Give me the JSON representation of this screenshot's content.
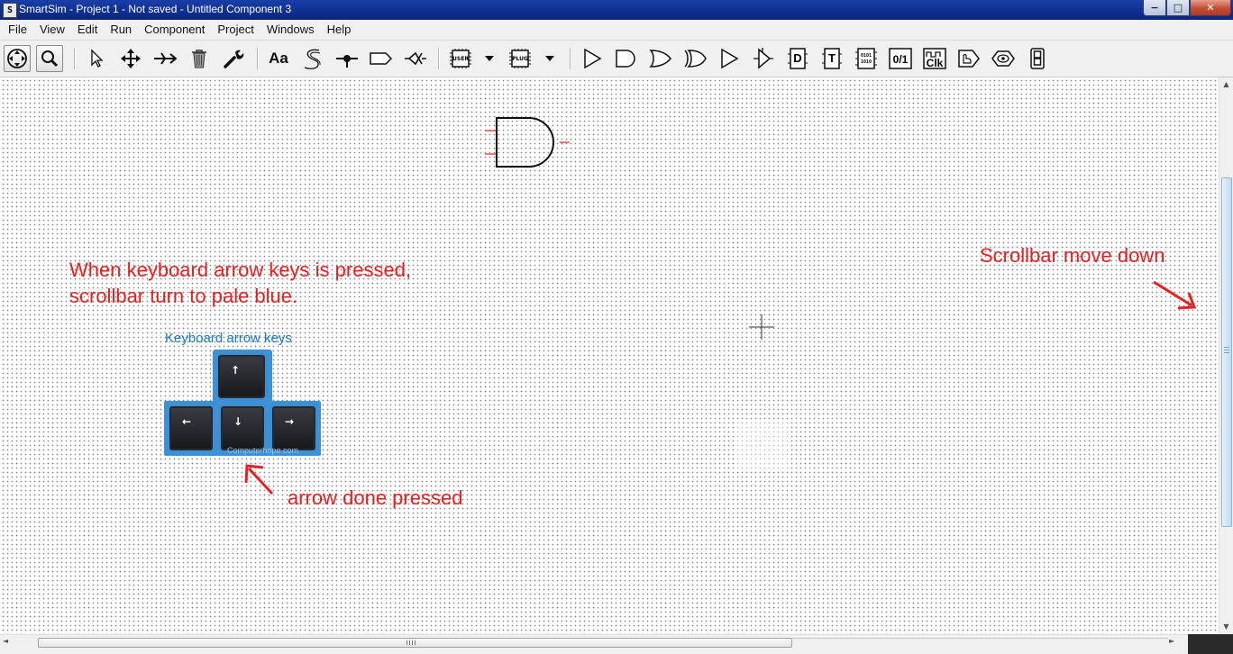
{
  "window": {
    "app_icon": "S",
    "title": "SmartSim - Project 1 - Not saved - Untitled Component 3",
    "buttons": {
      "minimize": "−",
      "maximize": "□",
      "close": "✕"
    }
  },
  "menu": {
    "items": [
      "File",
      "View",
      "Edit",
      "Run",
      "Component",
      "Project",
      "Windows",
      "Help"
    ]
  },
  "toolbar": {
    "text_tool": "Aa",
    "user_chip": "USER",
    "plug_chip": "PLUG",
    "d_flipflop": "D",
    "t_flipflop": "T",
    "toggle_01": "0/1",
    "clock_label": "Clk",
    "binary_a": "0101",
    "binary_b": "1010",
    "icons": [
      "pan-icon",
      "zoom-icon",
      "select-arrow-icon",
      "move-icon",
      "connect-icon",
      "delete-bin-icon",
      "properties-wrench-icon",
      "text-icon",
      "wire-s-icon",
      "junction-icon",
      "label-icon",
      "cross-icon",
      "user-component-chip-icon",
      "plugin-chip-icon",
      "buffer-gate-icon",
      "and-gate-icon",
      "or-gate-icon",
      "xor-gate-icon",
      "not-gate-icon",
      "tristate-icon",
      "d-flipflop-icon",
      "t-flipflop-icon",
      "register-icon",
      "toggle-switch-icon",
      "clock-icon",
      "input-pin-icon",
      "output-probe-icon",
      "seven-segment-icon"
    ]
  },
  "annotations": {
    "line1": "When keyboard arrow keys is pressed,",
    "line2": "scrollbar turn to pale blue.",
    "scroll_note": "Scrollbar move down",
    "arrow_note": "arrow done pressed",
    "keyboard_caption": "Keyboard arrow keys",
    "watermark": "Computerhope.com",
    "color": "#e62020"
  },
  "keys": {
    "up": "↑",
    "left": "←",
    "down": "↓",
    "right": "→"
  },
  "scrollbar": {
    "thumb_color": "#cfe6f8",
    "up": "▲",
    "down": "▼",
    "left": "◄",
    "right": "►"
  }
}
